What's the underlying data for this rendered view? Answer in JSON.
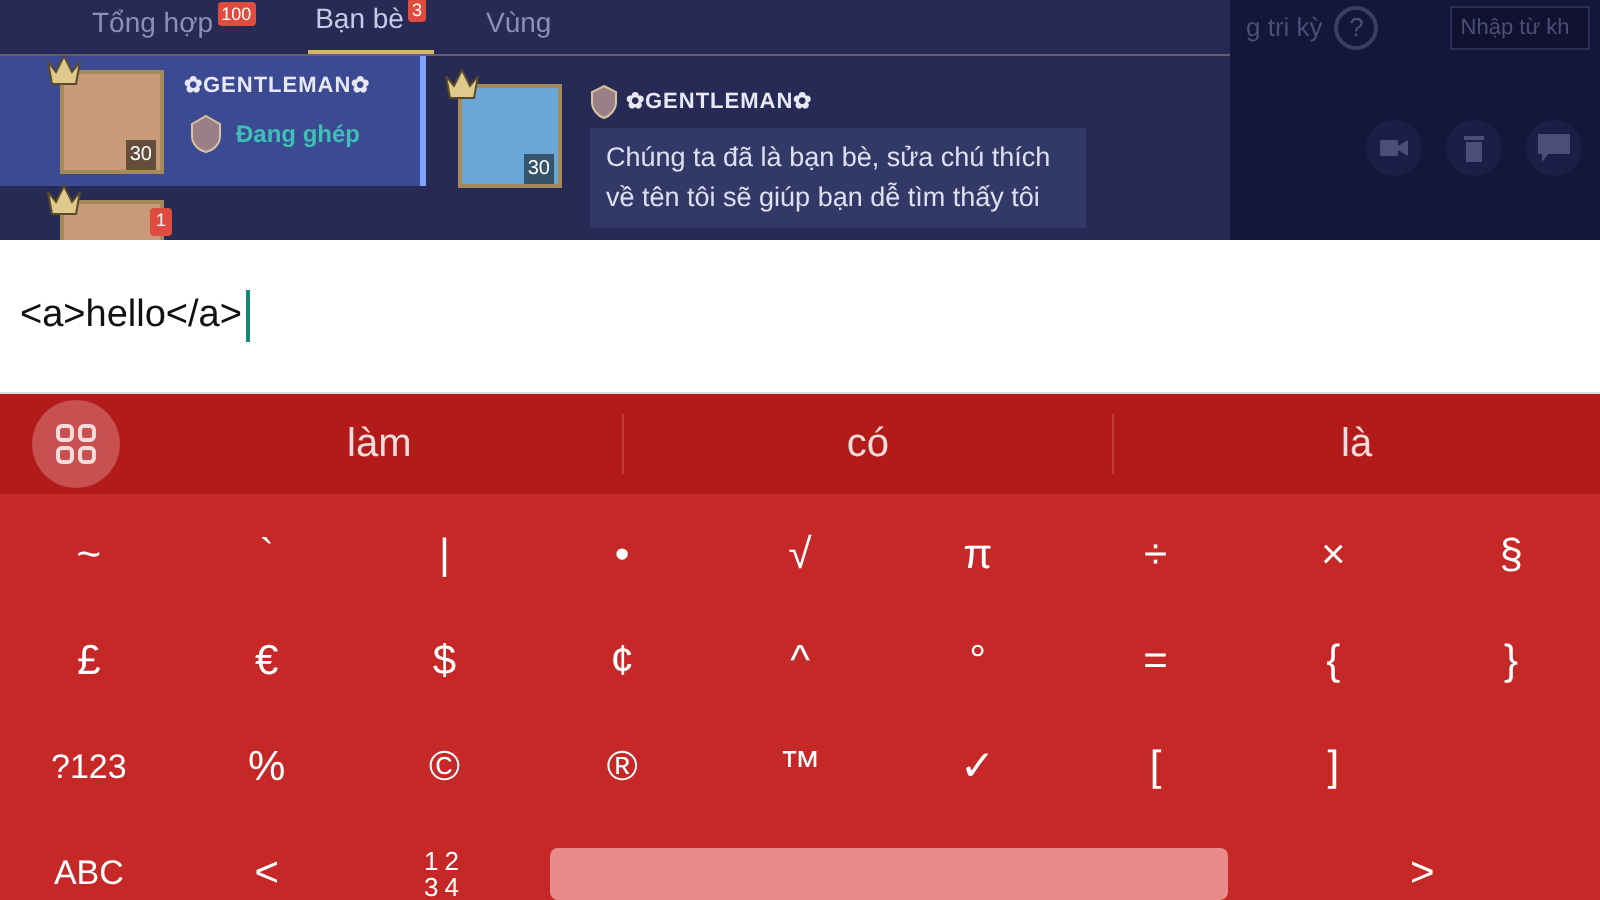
{
  "game": {
    "tabs": [
      {
        "label": "Tổng hợp",
        "badge": "100",
        "selected": false
      },
      {
        "label": "Bạn bè",
        "badge": "3",
        "selected": true
      },
      {
        "label": "Vùng",
        "selected": false
      }
    ],
    "header_right": {
      "label": "g tri kỳ",
      "help": "?",
      "search": {
        "placeholder": "Nhập từ kh"
      }
    },
    "friends": [
      {
        "name": "✿GENTLEMAN✿",
        "level": "30",
        "status": "Đang ghép",
        "selected": true
      },
      {
        "badge": "1",
        "selected": false
      }
    ],
    "chat": {
      "name": "✿GENTLEMAN✿",
      "level": "30",
      "message": "Chúng ta đã là bạn bè, sửa chú thích về tên tôi sẽ giúp bạn dễ tìm thấy tôi"
    }
  },
  "input": {
    "value": "<a>hello</a>"
  },
  "keyboard": {
    "suggestions": [
      "làm",
      "có",
      "là"
    ],
    "rows": [
      [
        {
          "kind": "char",
          "label": "~"
        },
        {
          "kind": "char",
          "label": "`"
        },
        {
          "kind": "char",
          "label": "|"
        },
        {
          "kind": "char",
          "label": "•"
        },
        {
          "kind": "char",
          "label": "√"
        },
        {
          "kind": "char",
          "label": "π"
        },
        {
          "kind": "char",
          "label": "÷"
        },
        {
          "kind": "char",
          "label": "×"
        },
        {
          "kind": "char",
          "label": "§"
        }
      ],
      [
        {
          "kind": "char",
          "label": "£"
        },
        {
          "kind": "char",
          "label": "€"
        },
        {
          "kind": "char",
          "label": "$"
        },
        {
          "kind": "char",
          "label": "¢"
        },
        {
          "kind": "char",
          "label": "^"
        },
        {
          "kind": "char",
          "label": "°"
        },
        {
          "kind": "char",
          "label": "="
        },
        {
          "kind": "char",
          "label": "{"
        },
        {
          "kind": "char",
          "label": "}"
        }
      ],
      [
        {
          "kind": "action",
          "label": "?123"
        },
        {
          "kind": "char",
          "label": "%"
        },
        {
          "kind": "char",
          "label": "©"
        },
        {
          "kind": "char",
          "label": "®"
        },
        {
          "kind": "char",
          "label": "™"
        },
        {
          "kind": "char",
          "label": "✓"
        },
        {
          "kind": "char",
          "label": "["
        },
        {
          "kind": "char",
          "label": "]"
        }
      ],
      [
        {
          "kind": "action",
          "label": "ABC"
        },
        {
          "kind": "char",
          "label": "<"
        },
        {
          "kind": "stack",
          "lines": [
            "12",
            "34"
          ]
        },
        {
          "kind": "space"
        },
        {
          "kind": "wide",
          "label": ">"
        }
      ]
    ]
  }
}
